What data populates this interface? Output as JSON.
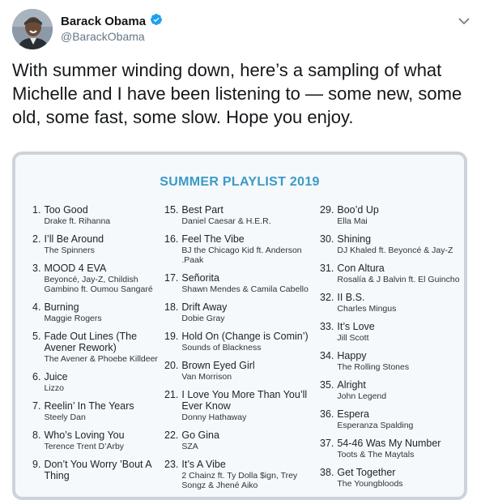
{
  "tweet": {
    "display_name": "Barack Obama",
    "handle": "@BarackObama",
    "verified": true,
    "text": "With summer winding down, here’s a sampling of what Michelle and I have been listening to — some new, some old, some fast, some slow. Hope you enjoy."
  },
  "playlist": {
    "title": "SUMMER PLAYLIST 2019",
    "columns": [
      [
        {
          "num": "1.",
          "song": "Too Good",
          "artist": "Drake ft. Rihanna"
        },
        {
          "num": "2.",
          "song": "I’ll Be Around",
          "artist": "The Spinners"
        },
        {
          "num": "3.",
          "song": "MOOD 4 EVA",
          "artist": "Beyoncé, Jay-Z, Childish Gambino ft. Oumou Sangaré"
        },
        {
          "num": "4.",
          "song": "Burning",
          "artist": "Maggie Rogers"
        },
        {
          "num": "5.",
          "song": "Fade Out Lines (The Avener Rework)",
          "artist": "The Avener & Phoebe Killdeer"
        },
        {
          "num": "6.",
          "song": "Juice",
          "artist": "Lizzo"
        },
        {
          "num": "7.",
          "song": "Reelin’ In The Years",
          "artist": "Steely Dan"
        },
        {
          "num": "8.",
          "song": "Who’s Loving You",
          "artist": "Terence Trent D’Arby"
        },
        {
          "num": "9.",
          "song": "Don’t You Worry ’Bout A Thing",
          "artist": ""
        }
      ],
      [
        {
          "num": "15.",
          "song": "Best Part",
          "artist": "Daniel Caesar & H.E.R."
        },
        {
          "num": "16.",
          "song": "Feel The Vibe",
          "artist": "BJ the Chicago Kid ft. Anderson .Paak"
        },
        {
          "num": "17.",
          "song": "Señorita",
          "artist": "Shawn Mendes & Camila Cabello"
        },
        {
          "num": "18.",
          "song": "Drift Away",
          "artist": "Dobie Gray"
        },
        {
          "num": "19.",
          "song": "Hold On (Change is Comin’)",
          "artist": "Sounds of Blackness"
        },
        {
          "num": "20.",
          "song": "Brown Eyed Girl",
          "artist": "Van Morrison"
        },
        {
          "num": "21.",
          "song": "I Love You More Than You’ll Ever Know",
          "artist": "Donny Hathaway"
        },
        {
          "num": "22.",
          "song": "Go Gina",
          "artist": "SZA"
        },
        {
          "num": "23.",
          "song": "It’s A Vibe",
          "artist": "2 Chainz ft. Ty Dolla $ign, Trey Songz & Jhené Aiko"
        }
      ],
      [
        {
          "num": "29.",
          "song": "Boo’d Up",
          "artist": "Ella Mai"
        },
        {
          "num": "30.",
          "song": "Shining",
          "artist": "DJ Khaled ft. Beyoncé & Jay-Z"
        },
        {
          "num": "31.",
          "song": "Con Altura",
          "artist": "Rosalía & J Balvin ft. El Guincho"
        },
        {
          "num": "32.",
          "song": "II B.S.",
          "artist": "Charles Mingus"
        },
        {
          "num": "33.",
          "song": "It’s Love",
          "artist": "Jill Scott"
        },
        {
          "num": "34.",
          "song": "Happy",
          "artist": "The Rolling Stones"
        },
        {
          "num": "35.",
          "song": "Alright",
          "artist": "John Legend"
        },
        {
          "num": "36.",
          "song": "Espera",
          "artist": "Esperanza Spalding"
        },
        {
          "num": "37.",
          "song": "54-46 Was My Number",
          "artist": "Toots & The Maytals"
        },
        {
          "num": "38.",
          "song": "Get Together",
          "artist": "The Youngbloods"
        }
      ]
    ]
  },
  "colors": {
    "title": "#3b9ac5",
    "verified": "#1da1f2",
    "card_bg": "#f5f9fc"
  },
  "icons": {
    "verified": "verified-badge-icon",
    "caret": "chevron-down-icon"
  }
}
